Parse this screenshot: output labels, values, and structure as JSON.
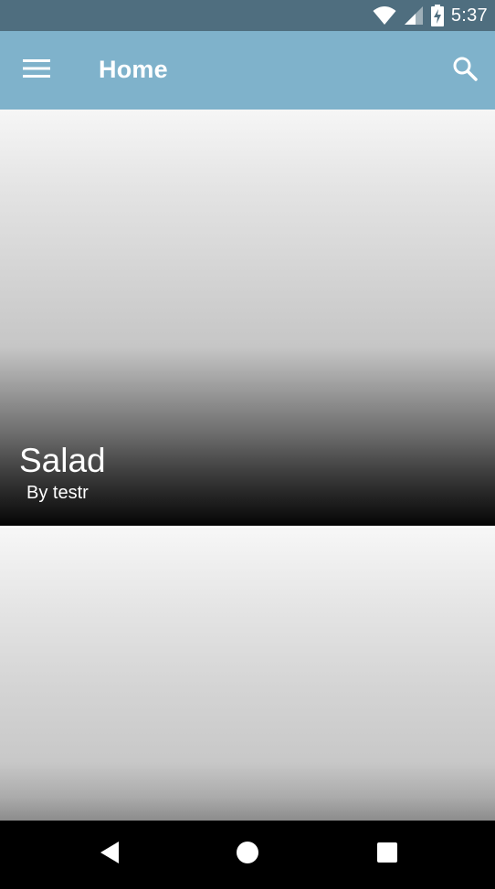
{
  "status_bar": {
    "time": "5:37",
    "icons": [
      "wifi-icon",
      "cell-signal-icon",
      "battery-charging-icon"
    ],
    "background": "#4f6e7f"
  },
  "app_bar": {
    "title": "Home",
    "background": "#7fb2cb",
    "icons": [
      "menu-icon",
      "search-icon"
    ]
  },
  "recipes": [
    {
      "title": "Salad",
      "author": "By testr"
    },
    {
      "title": "",
      "author": ""
    }
  ],
  "nav_bar": {
    "icons": [
      "back-icon",
      "home-icon",
      "recents-icon"
    ]
  }
}
